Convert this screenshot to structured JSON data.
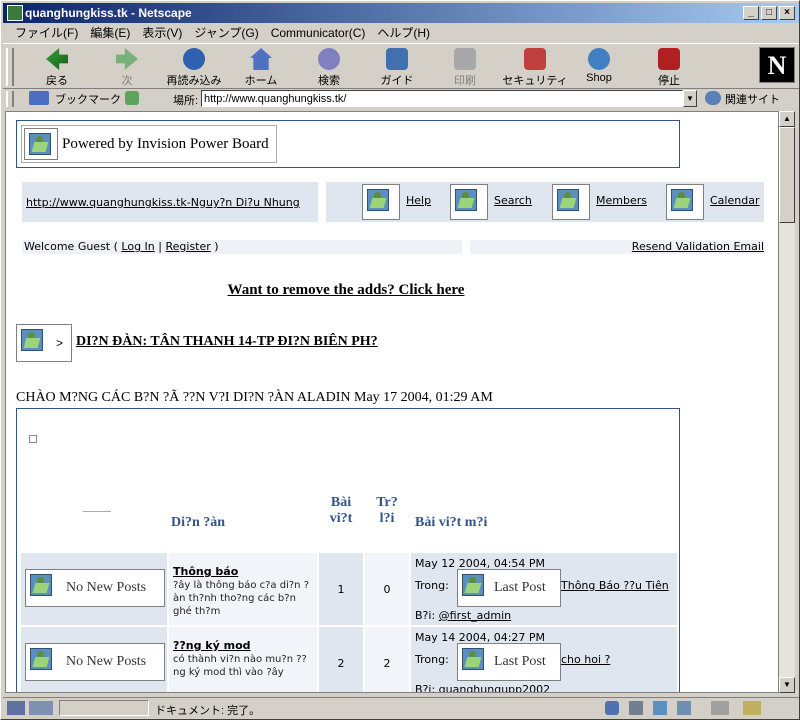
{
  "window": {
    "title": "quanghungkiss.tk - Netscape"
  },
  "menu": [
    "ファイル(F)",
    "編集(E)",
    "表示(V)",
    "ジャンプ(G)",
    "Communicator(C)",
    "ヘルプ(H)"
  ],
  "toolbar": {
    "back": "戻る",
    "forward": "次",
    "reload": "再読み込み",
    "home": "ホーム",
    "search": "検索",
    "guide": "ガイド",
    "print": "印刷",
    "security": "セキュリティ",
    "shop": "Shop",
    "stop": "停止"
  },
  "location": {
    "bookmarks": "ブックマーク",
    "label": "場所:",
    "url": "http://www.quanghungkiss.tk/",
    "related": "関連サイト"
  },
  "page": {
    "powered": "Powered by Invision Power Board",
    "site_link": "http://www.quanghungkiss.tk-Nguy?n Di?u Nhung",
    "nav": {
      "help": "Help",
      "search": "Search",
      "members": "Members",
      "calendar": "Calendar"
    },
    "welcome": {
      "prefix": "Welcome Guest ( ",
      "login": "Log In",
      "sep": " | ",
      "register": "Register",
      "suffix": " )"
    },
    "resend": "Resend Validation Email",
    "ads": "Want to remove the adds? Click here",
    "forum_arrow": ">",
    "forum_title": "DI?N ĐÀN: TÂN THANH 14-TP ĐI?N BIÊN PH?",
    "welcome_line": "CHÀO M?NG CÁC B?N ?Ã ??N V?I DI?N ?ÀN ALADIN May 17 2004, 01:29 AM",
    "table_headers": {
      "forum": "Di?n ?àn",
      "posts_line1": "Bài",
      "posts_line2": "vi?t",
      "replies_line1": "Tr?",
      "replies_line2": "l?i",
      "last": "Bài vi?t m?i"
    },
    "rows": [
      {
        "icon_label": "No New Posts",
        "name": "Thông báo",
        "desc": "?ây là thông báo c?a di?n ?àn th?nh tho?ng các b?n ghé th?m",
        "posts": "1",
        "replies": "0",
        "last_date": "May 12 2004, 04:54 PM",
        "last_in": "Trong:",
        "last_img": "Last Post",
        "last_topic": "Thông Báo ??u Tiên",
        "last_by": "B?i:",
        "last_user": "@first_admin"
      },
      {
        "icon_label": "No New Posts",
        "name": "??ng ký mod",
        "desc": "có thành vi?n nào mu?n ??ng ký mod thì vào ?ây",
        "posts": "2",
        "replies": "2",
        "last_date": "May 14 2004, 04:27 PM",
        "last_in": "Trong:",
        "last_img": "Last Post",
        "last_topic": "cho hoi ?",
        "last_by": "B?i:",
        "last_user": "quanghungupp2002"
      }
    ]
  },
  "status": {
    "text": "ドキュメント: 完了。"
  }
}
